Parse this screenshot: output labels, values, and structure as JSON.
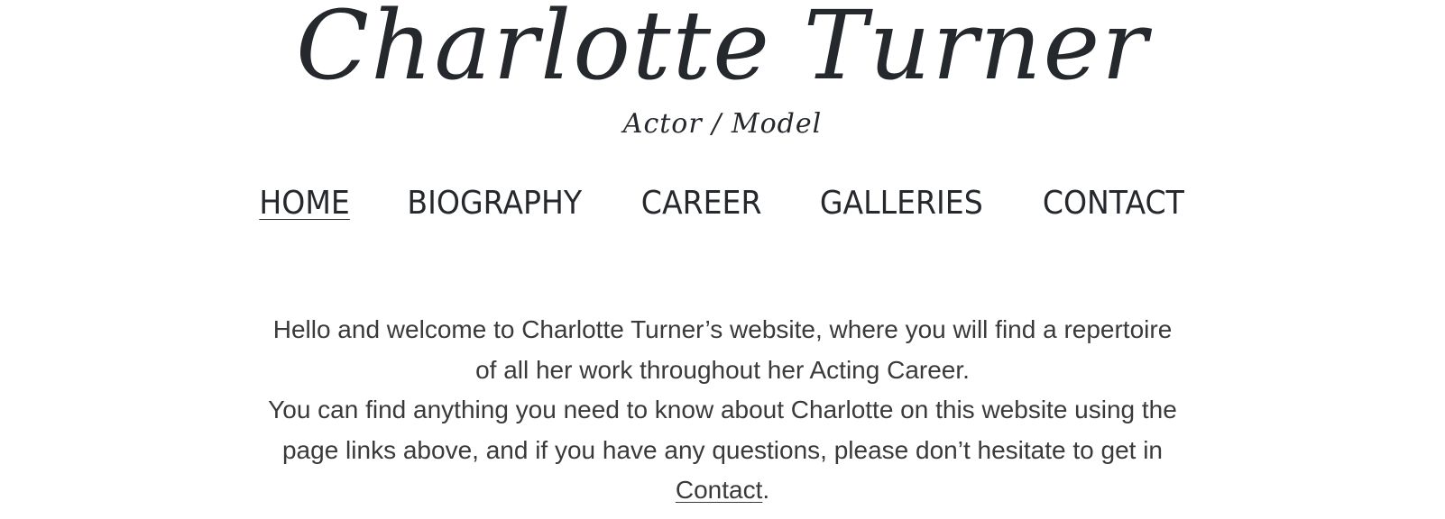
{
  "site": {
    "title": "Charlotte Turner",
    "subtitle": "Actor / Model"
  },
  "nav": {
    "items": [
      {
        "label": "HOME",
        "active": true
      },
      {
        "label": "BIOGRAPHY",
        "active": false
      },
      {
        "label": "CAREER",
        "active": false
      },
      {
        "label": "GALLERIES",
        "active": false
      },
      {
        "label": "CONTACT",
        "active": false
      }
    ]
  },
  "intro": {
    "line1": "Hello and welcome to Charlotte Turner’s website, where you will find a repertoire",
    "line2": "of all her work throughout her Acting Career.",
    "line3": "You can find anything you need to know about Charlotte on this website using the",
    "line4": "page links above, and if you have any questions, please don’t hesitate to get in",
    "contact_link": "Contact",
    "end_punct": "."
  },
  "colors": {
    "text": "#25282c",
    "body_text": "#3a3a3a",
    "background": "#ffffff"
  }
}
